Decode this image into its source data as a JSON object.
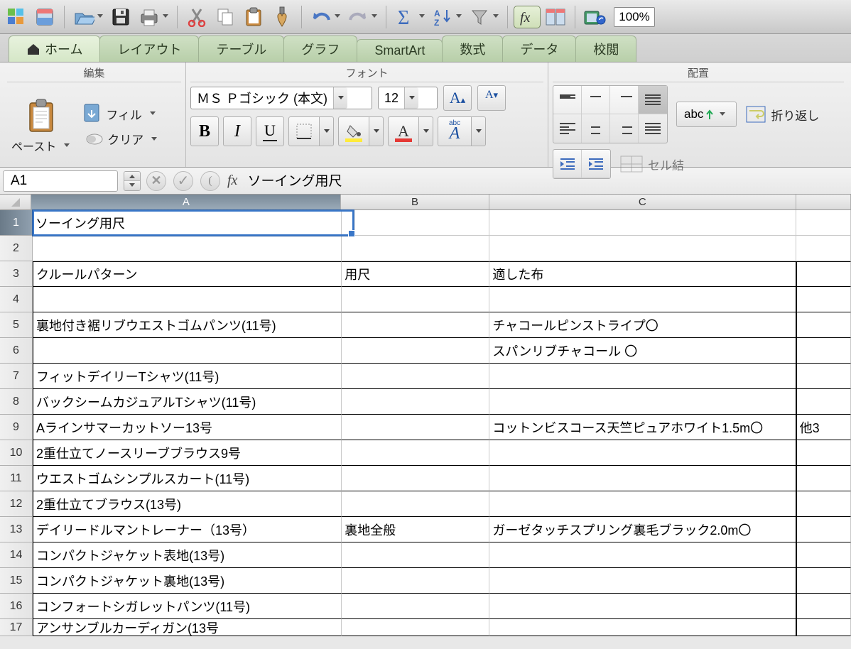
{
  "toolbar": {
    "zoom": "100%"
  },
  "tabs": {
    "home": "ホーム",
    "layout": "レイアウト",
    "table": "テーブル",
    "chart": "グラフ",
    "smartart": "SmartArt",
    "formula": "数式",
    "data": "データ",
    "review": "校閲"
  },
  "ribbon": {
    "group_edit": "編集",
    "group_font": "フォント",
    "group_align": "配置",
    "paste": "ペースト",
    "fill": "フィル",
    "clear": "クリア",
    "font_name": "ＭＳ Ｐゴシック (本文)",
    "font_size": "12",
    "orientation_abc": "abc",
    "wrap": "折り返し",
    "merge": "セル結"
  },
  "formula_bar": {
    "name_box": "A1",
    "fx_label": "fx",
    "value": "ソーイング用尺"
  },
  "columns": [
    "A",
    "B",
    "C"
  ],
  "row_labels": [
    "1",
    "2",
    "3",
    "4",
    "5",
    "6",
    "7",
    "8",
    "9",
    "10",
    "11",
    "12",
    "13",
    "14",
    "15",
    "16",
    "17"
  ],
  "cells": {
    "r1": {
      "a": "ソーイング用尺",
      "b": "",
      "c": "",
      "d": ""
    },
    "r2": {
      "a": "",
      "b": "",
      "c": "",
      "d": ""
    },
    "r3": {
      "a": "クルールパターン",
      "b": "用尺",
      "c": "適した布",
      "d": ""
    },
    "r4": {
      "a": "",
      "b": "",
      "c": "",
      "d": ""
    },
    "r5": {
      "a": "裏地付き裾リブウエストゴムパンツ(11号)",
      "b": "",
      "c": "チャコールピンストライプ〇",
      "d": ""
    },
    "r6": {
      "a": "",
      "b": "",
      "c": "スパンリブチャコール  〇",
      "d": ""
    },
    "r7": {
      "a": "フィットデイリーTシャツ(11号)",
      "b": "",
      "c": "",
      "d": ""
    },
    "r8": {
      "a": "バックシームカジュアルTシャツ(11号)",
      "b": "",
      "c": "",
      "d": ""
    },
    "r9": {
      "a": "Aラインサマーカットソー13号",
      "b": "",
      "c": "コットンビスコース天竺ピュアホワイト1.5m〇",
      "d": "他3"
    },
    "r10": {
      "a": "2重仕立てノースリーブブラウス9号",
      "b": "",
      "c": "",
      "d": ""
    },
    "r11": {
      "a": "ウエストゴムシンプルスカート(11号)",
      "b": "",
      "c": "",
      "d": ""
    },
    "r12": {
      "a": "2重仕立てブラウス(13号)",
      "b": "",
      "c": "",
      "d": ""
    },
    "r13": {
      "a": "デイリードルマントレーナー（13号）",
      "b": "裏地全般",
      "c": "ガーゼタッチスプリング裏毛ブラック2.0m〇",
      "d": ""
    },
    "r14": {
      "a": "コンパクトジャケット表地(13号)",
      "b": "",
      "c": "",
      "d": ""
    },
    "r15": {
      "a": "コンパクトジャケット裏地(13号)",
      "b": "",
      "c": "",
      "d": ""
    },
    "r16": {
      "a": "コンフォートシガレットパンツ(11号)",
      "b": "",
      "c": "",
      "d": ""
    },
    "r17": {
      "a": "アンサンブルカーディガン(13号",
      "b": "",
      "c": "",
      "d": ""
    }
  }
}
